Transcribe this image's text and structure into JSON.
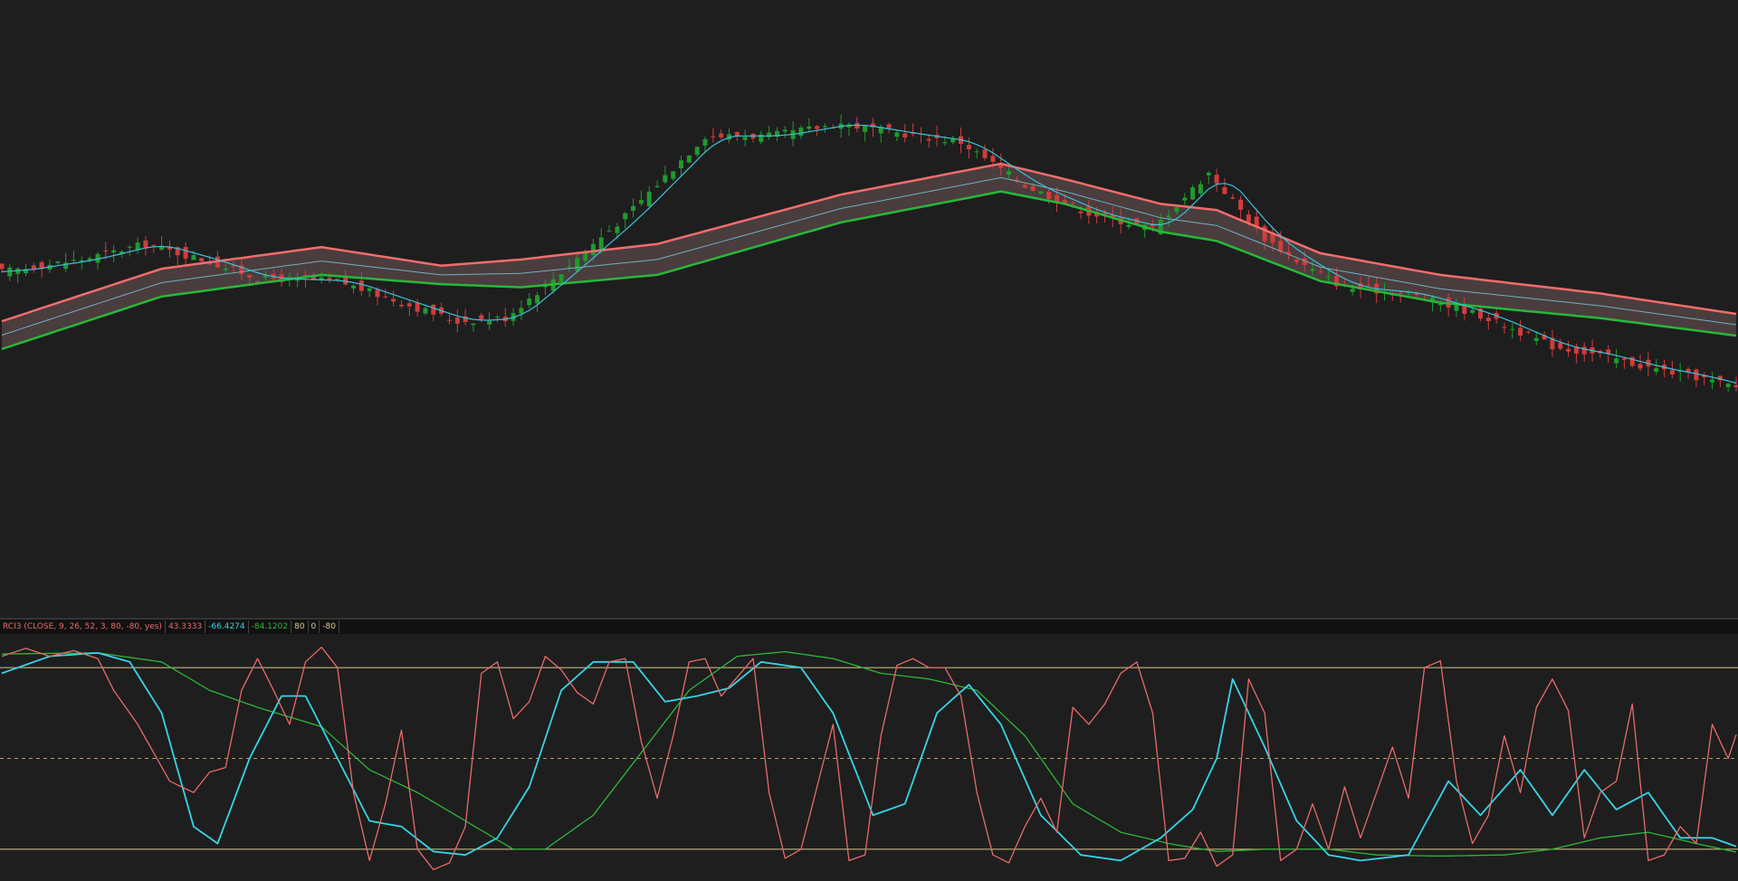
{
  "study": {
    "title": "RCI3 (CLOSE, 9, 26, 52, 3, 80, -80, yes)",
    "short_value": "43.3333",
    "middle_value": "-66.4274",
    "long_value": "-84.1202",
    "upper_level": "80",
    "zero_level": "0",
    "lower_level": "-80"
  },
  "colors": {
    "background": "#1e1e1e",
    "up_candle": "#1f9a2e",
    "down_candle": "#d13c3c",
    "band_upper": "#f26d6d",
    "band_lower": "#26b83a",
    "band_fill": "#5a4848",
    "band_mid": "#6fb0c4",
    "ma_fast": "#3cc0d8",
    "rci_short": "#e86a6a",
    "rci_middle": "#36d4e6",
    "rci_long": "#2db63a",
    "level_line": "#d8c890",
    "zero_line": "#b8a060"
  },
  "chart_data": [
    {
      "type": "candlestick",
      "overlays": [
        "moving-average-envelope-upper",
        "moving-average-envelope-middle",
        "moving-average-envelope-lower",
        "fast-moving-average"
      ],
      "bars": 218,
      "y_range": [
        0,
        100
      ],
      "close_path": [
        [
          0,
          56.0
        ],
        [
          10,
          58.0
        ],
        [
          18,
          60.5
        ],
        [
          25,
          58.0
        ],
        [
          32,
          55.0
        ],
        [
          42,
          54.5
        ],
        [
          50,
          51.0
        ],
        [
          57,
          48.0
        ],
        [
          63,
          48.5
        ],
        [
          70,
          56.0
        ],
        [
          78,
          65.0
        ],
        [
          88,
          78.0
        ],
        [
          96,
          78.0
        ],
        [
          105,
          80.0
        ],
        [
          112,
          78.5
        ],
        [
          120,
          77.0
        ],
        [
          128,
          70.0
        ],
        [
          136,
          65.5
        ],
        [
          144,
          63.0
        ],
        [
          151,
          72.0
        ],
        [
          158,
          61.5
        ],
        [
          163,
          57.0
        ],
        [
          168,
          53.5
        ],
        [
          176,
          52.5
        ],
        [
          185,
          49.0
        ],
        [
          194,
          44.0
        ],
        [
          200,
          42.5
        ],
        [
          206,
          40.5
        ],
        [
          212,
          39.0
        ],
        [
          218,
          37.0
        ]
      ],
      "envelope_upper": [
        [
          0,
          48.0
        ],
        [
          20,
          56.5
        ],
        [
          40,
          60.0
        ],
        [
          55,
          57.0
        ],
        [
          65,
          58.0
        ],
        [
          82,
          60.5
        ],
        [
          105,
          68.5
        ],
        [
          125,
          73.5
        ],
        [
          133,
          71.0
        ],
        [
          145,
          67.0
        ],
        [
          152,
          66.0
        ],
        [
          165,
          59.0
        ],
        [
          180,
          55.5
        ],
        [
          200,
          52.5
        ],
        [
          218,
          49.0
        ]
      ],
      "envelope_lower": [
        [
          0,
          43.5
        ],
        [
          20,
          52.0
        ],
        [
          40,
          55.5
        ],
        [
          55,
          54.0
        ],
        [
          65,
          53.5
        ],
        [
          82,
          55.5
        ],
        [
          105,
          64.0
        ],
        [
          125,
          69.0
        ],
        [
          133,
          67.0
        ],
        [
          145,
          62.5
        ],
        [
          152,
          61.0
        ],
        [
          165,
          54.5
        ],
        [
          180,
          51.0
        ],
        [
          200,
          48.5
        ],
        [
          218,
          45.5
        ]
      ]
    },
    {
      "type": "line",
      "title": "RCI3 (CLOSE, 9, 26, 52, 3, 80, -80, yes)",
      "y_range": [
        -100,
        100
      ],
      "levels": [
        80,
        0,
        -80
      ],
      "series": [
        {
          "name": "short",
          "values": [
            [
              0,
              90
            ],
            [
              3,
              97
            ],
            [
              6,
              90
            ],
            [
              9,
              95
            ],
            [
              12,
              88
            ],
            [
              14,
              60
            ],
            [
              17,
              30
            ],
            [
              19,
              5
            ],
            [
              21,
              -20
            ],
            [
              24,
              -30
            ],
            [
              26,
              -12
            ],
            [
              28,
              -8
            ],
            [
              30,
              60
            ],
            [
              32,
              88
            ],
            [
              34,
              60
            ],
            [
              36,
              30
            ],
            [
              38,
              85
            ],
            [
              40,
              98
            ],
            [
              42,
              80
            ],
            [
              44,
              -30
            ],
            [
              46,
              -90
            ],
            [
              48,
              -40
            ],
            [
              50,
              25
            ],
            [
              52,
              -80
            ],
            [
              54,
              -98
            ],
            [
              56,
              -92
            ],
            [
              58,
              -60
            ],
            [
              60,
              75
            ],
            [
              62,
              85
            ],
            [
              64,
              35
            ],
            [
              66,
              50
            ],
            [
              68,
              90
            ],
            [
              70,
              78
            ],
            [
              72,
              58
            ],
            [
              74,
              48
            ],
            [
              76,
              85
            ],
            [
              78,
              88
            ],
            [
              80,
              15
            ],
            [
              82,
              -35
            ],
            [
              84,
              20
            ],
            [
              86,
              85
            ],
            [
              88,
              88
            ],
            [
              90,
              55
            ],
            [
              94,
              88
            ],
            [
              96,
              -30
            ],
            [
              98,
              -88
            ],
            [
              100,
              -80
            ],
            [
              102,
              -25
            ],
            [
              104,
              30
            ],
            [
              106,
              -90
            ],
            [
              108,
              -85
            ],
            [
              110,
              20
            ],
            [
              112,
              82
            ],
            [
              114,
              88
            ],
            [
              116,
              80
            ],
            [
              118,
              80
            ],
            [
              120,
              55
            ],
            [
              122,
              -30
            ],
            [
              124,
              -85
            ],
            [
              126,
              -92
            ],
            [
              128,
              -60
            ],
            [
              130,
              -35
            ],
            [
              132,
              -65
            ],
            [
              134,
              45
            ],
            [
              136,
              30
            ],
            [
              138,
              48
            ],
            [
              140,
              75
            ],
            [
              142,
              85
            ],
            [
              144,
              40
            ],
            [
              146,
              -90
            ],
            [
              148,
              -88
            ],
            [
              150,
              -65
            ],
            [
              152,
              -95
            ],
            [
              154,
              -85
            ],
            [
              156,
              70
            ],
            [
              158,
              40
            ],
            [
              160,
              -90
            ],
            [
              162,
              -80
            ],
            [
              164,
              -40
            ],
            [
              166,
              -80
            ],
            [
              168,
              -25
            ],
            [
              170,
              -70
            ],
            [
              172,
              -30
            ],
            [
              174,
              10
            ],
            [
              176,
              -35
            ],
            [
              178,
              80
            ],
            [
              180,
              86
            ],
            [
              182,
              -20
            ],
            [
              184,
              -75
            ],
            [
              186,
              -50
            ],
            [
              188,
              20
            ],
            [
              190,
              -30
            ],
            [
              192,
              45
            ],
            [
              194,
              70
            ],
            [
              196,
              42
            ],
            [
              198,
              -70
            ],
            [
              200,
              -30
            ],
            [
              202,
              -20
            ],
            [
              204,
              48
            ],
            [
              206,
              -90
            ],
            [
              208,
              -85
            ],
            [
              210,
              -60
            ],
            [
              212,
              -75
            ],
            [
              214,
              30
            ],
            [
              216,
              0
            ],
            [
              218,
              42
            ]
          ]
        },
        {
          "name": "middle",
          "values": [
            [
              0,
              75
            ],
            [
              6,
              90
            ],
            [
              12,
              93
            ],
            [
              16,
              85
            ],
            [
              20,
              40
            ],
            [
              24,
              -60
            ],
            [
              27,
              -75
            ],
            [
              31,
              0
            ],
            [
              35,
              55
            ],
            [
              38,
              55
            ],
            [
              42,
              0
            ],
            [
              46,
              -55
            ],
            [
              50,
              -60
            ],
            [
              54,
              -82
            ],
            [
              58,
              -85
            ],
            [
              62,
              -70
            ],
            [
              66,
              -25
            ],
            [
              70,
              60
            ],
            [
              74,
              85
            ],
            [
              79,
              85
            ],
            [
              83,
              50
            ],
            [
              87,
              55
            ],
            [
              91,
              62
            ],
            [
              95,
              85
            ],
            [
              100,
              80
            ],
            [
              104,
              40
            ],
            [
              109,
              -50
            ],
            [
              113,
              -40
            ],
            [
              117,
              40
            ],
            [
              121,
              65
            ],
            [
              125,
              30
            ],
            [
              130,
              -50
            ],
            [
              135,
              -85
            ],
            [
              140,
              -90
            ],
            [
              145,
              -70
            ],
            [
              149,
              -45
            ],
            [
              152,
              0
            ],
            [
              154,
              70
            ],
            [
              158,
              10
            ],
            [
              162,
              -55
            ],
            [
              166,
              -85
            ],
            [
              170,
              -90
            ],
            [
              176,
              -85
            ],
            [
              181,
              -20
            ],
            [
              185,
              -50
            ],
            [
              190,
              -10
            ],
            [
              194,
              -50
            ],
            [
              198,
              -10
            ],
            [
              202,
              -45
            ],
            [
              206,
              -30
            ],
            [
              210,
              -70
            ],
            [
              214,
              -70
            ],
            [
              218,
              -80
            ]
          ]
        },
        {
          "name": "long",
          "values": [
            [
              0,
              92
            ],
            [
              12,
              93
            ],
            [
              20,
              85
            ],
            [
              26,
              60
            ],
            [
              32,
              45
            ],
            [
              40,
              28
            ],
            [
              46,
              -10
            ],
            [
              52,
              -30
            ],
            [
              58,
              -55
            ],
            [
              64,
              -80
            ],
            [
              68,
              -80
            ],
            [
              74,
              -50
            ],
            [
              80,
              5
            ],
            [
              86,
              60
            ],
            [
              92,
              90
            ],
            [
              98,
              94
            ],
            [
              104,
              88
            ],
            [
              110,
              75
            ],
            [
              116,
              70
            ],
            [
              122,
              60
            ],
            [
              128,
              20
            ],
            [
              134,
              -40
            ],
            [
              140,
              -65
            ],
            [
              146,
              -75
            ],
            [
              152,
              -82
            ],
            [
              158,
              -80
            ],
            [
              166,
              -80
            ],
            [
              172,
              -85
            ],
            [
              180,
              -86
            ],
            [
              188,
              -85
            ],
            [
              194,
              -80
            ],
            [
              200,
              -70
            ],
            [
              206,
              -65
            ],
            [
              212,
              -75
            ],
            [
              218,
              -84
            ]
          ]
        }
      ]
    }
  ]
}
